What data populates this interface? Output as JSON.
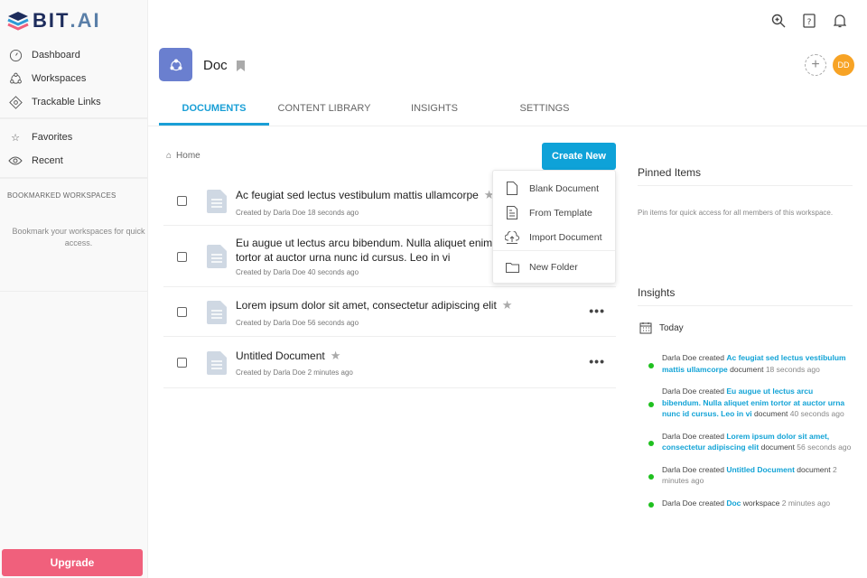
{
  "app": {
    "logo": "BIT",
    "logo_suffix": ".AI"
  },
  "sidebar": {
    "items": [
      {
        "label": "Dashboard"
      },
      {
        "label": "Workspaces"
      },
      {
        "label": "Trackable Links"
      }
    ],
    "items2": [
      {
        "label": "Favorites"
      },
      {
        "label": "Recent"
      }
    ],
    "bookmarked_title": "BOOKMARKED WORKSPACES",
    "bookmarked_empty": "Bookmark your workspaces for quick access.",
    "upgrade": "Upgrade"
  },
  "workspace": {
    "name": "Doc",
    "avatar_initials": "DD",
    "add": "+"
  },
  "tabs": [
    "DOCUMENTS",
    "CONTENT LIBRARY",
    "INSIGHTS",
    "SETTINGS"
  ],
  "breadcrumb": "Home",
  "create_new": "Create New",
  "menu": [
    "Blank Document",
    "From Template",
    "Import Document",
    "New Folder"
  ],
  "documents": [
    {
      "title": "Ac feugiat sed lectus vestibulum mattis ullamcorpe",
      "meta": "Created by Darla Doe 18 seconds ago"
    },
    {
      "title": "Eu augue ut lectus arcu bibendum. Nulla aliquet enim tortor at auctor urna nunc id cursus. Leo in vi",
      "meta": "Created by Darla Doe 40 seconds ago"
    },
    {
      "title": "Lorem ipsum dolor sit amet, consectetur adipiscing elit",
      "meta": "Created by Darla Doe 56 seconds ago"
    },
    {
      "title": "Untitled Document",
      "meta": "Created by Darla Doe 2 minutes ago"
    }
  ],
  "more": "•••",
  "pinned": {
    "title": "Pinned Items",
    "empty": "Pin items for quick access for all members of this workspace."
  },
  "insights": {
    "title": "Insights",
    "today": "Today",
    "feed": [
      {
        "actor": "Darla Doe created ",
        "link": "Ac feugiat sed lectus vestibulum mattis ullamcorpe",
        "type": " document ",
        "time": "18 seconds ago"
      },
      {
        "actor": "Darla Doe created ",
        "link": "Eu augue ut lectus arcu bibendum. Nulla aliquet enim tortor at auctor urna nunc id cursus. Leo in vi",
        "type": " document ",
        "time": "40 seconds ago"
      },
      {
        "actor": "Darla Doe created ",
        "link": "Lorem ipsum dolor sit amet, consectetur adipiscing elit",
        "type": " document ",
        "time": "56 seconds ago"
      },
      {
        "actor": "Darla Doe created ",
        "link": "Untitled Document",
        "type": " document ",
        "time": "2 minutes ago"
      },
      {
        "actor": "Darla Doe created ",
        "link": "Doc",
        "type": " workspace ",
        "time": "2 minutes ago"
      }
    ]
  }
}
